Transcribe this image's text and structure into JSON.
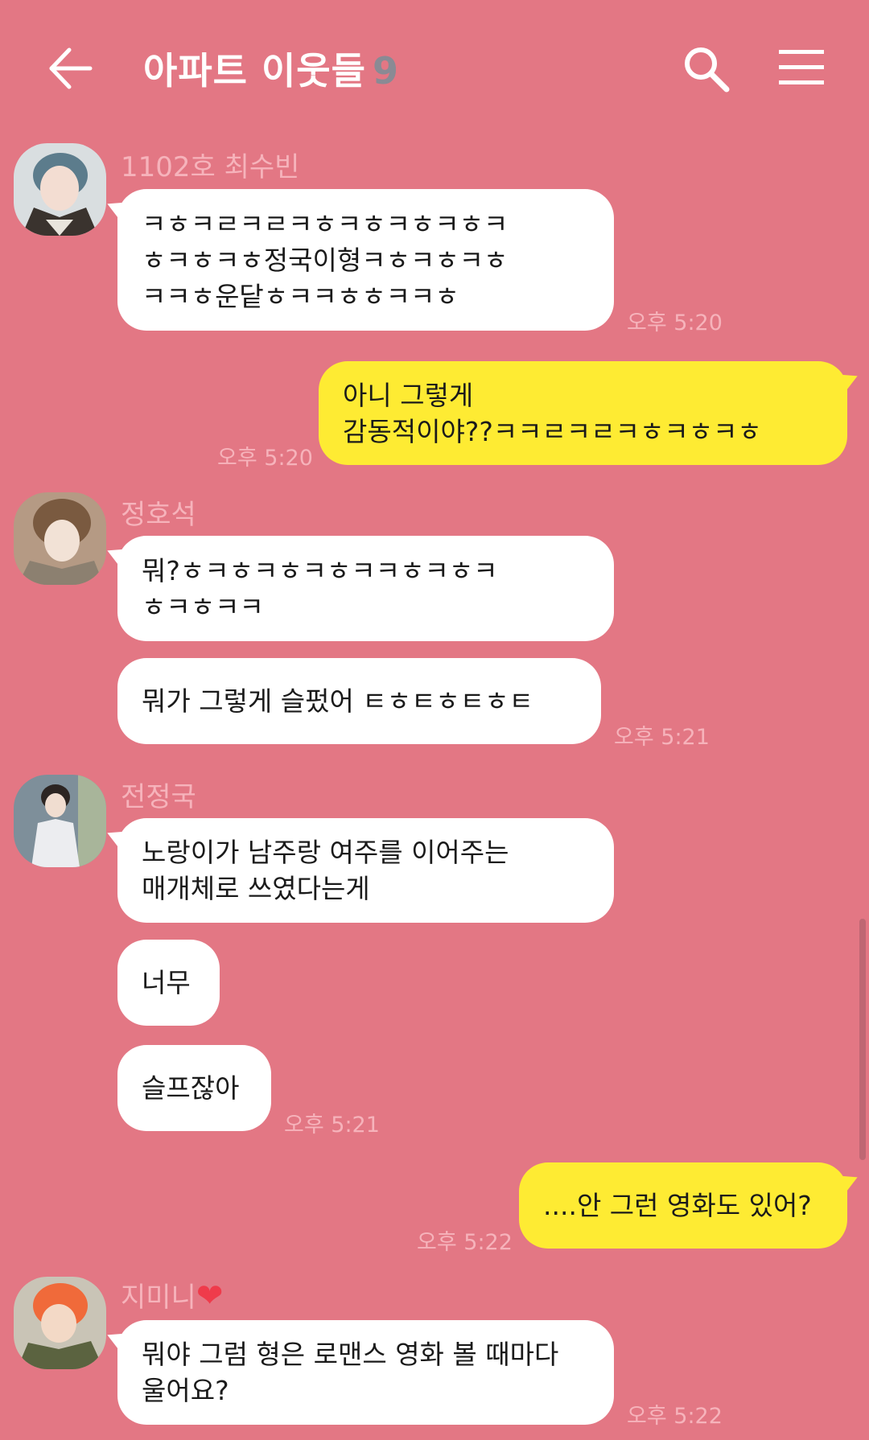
{
  "header": {
    "title": "아파트 이웃들",
    "member_count": "9",
    "back_icon": "arrow-left-icon",
    "search_icon": "search-icon",
    "menu_icon": "hamburger-menu-icon"
  },
  "colors": {
    "background": "#e37784",
    "my_bubble": "#feeb33",
    "other_bubble": "#ffffff",
    "meta_text": "#f6b3bb"
  },
  "messages": [
    {
      "sender": "1102호 최수빈",
      "bubbles": [
        "ㅋㅎㅋㄹㅋㄹㅋㅎㅋㅎㅋㅎㅋㅎㅋ\nㅎㅋㅎㅋㅎ정국이형ㅋㅎㅋㅎㅋㅎ\nㅋㅋㅎ운닽ㅎㅋㅋㅎㅎㅋㅋㅎ"
      ],
      "time": "오후 5:20"
    },
    {
      "sender": "me",
      "bubbles": [
        "아니 그렇게\n감동적이야??ㅋㅋㄹㅋㄹㅋㅎㅋㅎㅋㅎ"
      ],
      "time": "오후 5:20"
    },
    {
      "sender": "정호석",
      "bubbles": [
        "뭐?ㅎㅋㅎㅋㅎㅋㅎㅋㅋㅎㅋㅎㅋ\nㅎㅋㅎㅋㅋ",
        "뭐가 그렇게 슬펐어 ㅌㅎㅌㅎㅌㅎㅌ"
      ],
      "time": "오후 5:21"
    },
    {
      "sender": "전정국",
      "bubbles": [
        "노랑이가 남주랑 여주를 이어주는\n매개체로 쓰였다는게",
        "너무",
        "슬프잖아"
      ],
      "time": "오후 5:21"
    },
    {
      "sender": "me",
      "bubbles": [
        "....안 그런 영화도 있어?"
      ],
      "time": "오후 5:22"
    },
    {
      "sender": "지미니",
      "bubbles": [
        "뭐야 그럼 형은 로맨스 영화 볼 때마다\n울어요?"
      ],
      "time": "오후 5:22"
    }
  ]
}
